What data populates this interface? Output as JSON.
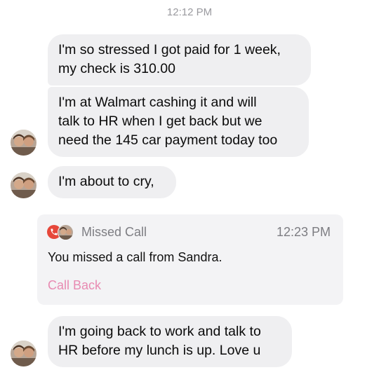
{
  "timestamp": "12:12 PM",
  "messages": [
    "I'm so stressed I got paid for 1 week,\nmy check is 310.00",
    "I'm at Walmart cashing it and will\ntalk to HR when I get back but we\nneed the 145 car payment today too",
    "I'm about to cry,",
    "I'm going back to work and talk to\nHR before my lunch is up.  Love u"
  ],
  "missed_call": {
    "title": "Missed Call",
    "time": "12:23 PM",
    "body": "You missed a call from Sandra.",
    "action": "Call Back"
  },
  "colors": {
    "bubble": "#efeff1",
    "card": "#f3f3f5",
    "missed_icon": "#e6473a",
    "call_back": "#e88bb2"
  }
}
